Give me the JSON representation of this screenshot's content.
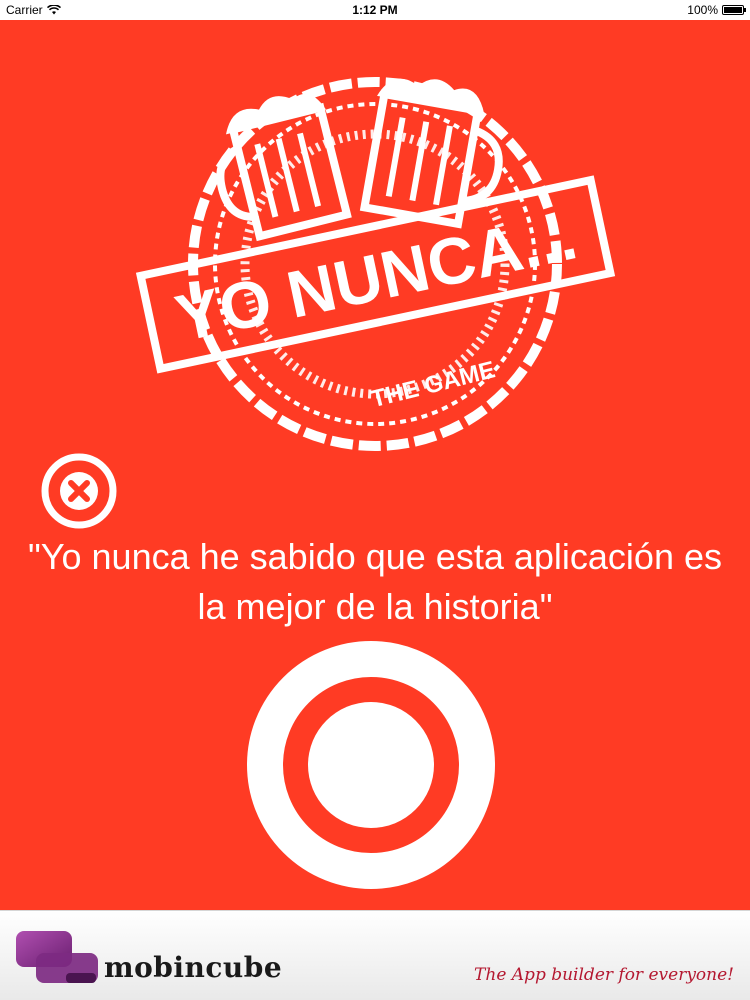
{
  "status_bar": {
    "carrier": "Carrier",
    "time": "1:12 PM",
    "battery": "100%",
    "battery_level": 1.0
  },
  "app": {
    "background_color": "#ff3b24",
    "logo": {
      "title": "YO NUNCA...",
      "subtitle": "THE GAME"
    },
    "close_icon": "close-circle-icon",
    "quote": "\"Yo nunca he sabido que esta aplicación es la mejor de la historia\"",
    "record_icon": "record-circle-icon"
  },
  "footer": {
    "brand": "mobincube",
    "tagline": "The App builder for everyone!",
    "brand_color": "#8e2a8c",
    "tagline_color": "#b41830"
  }
}
